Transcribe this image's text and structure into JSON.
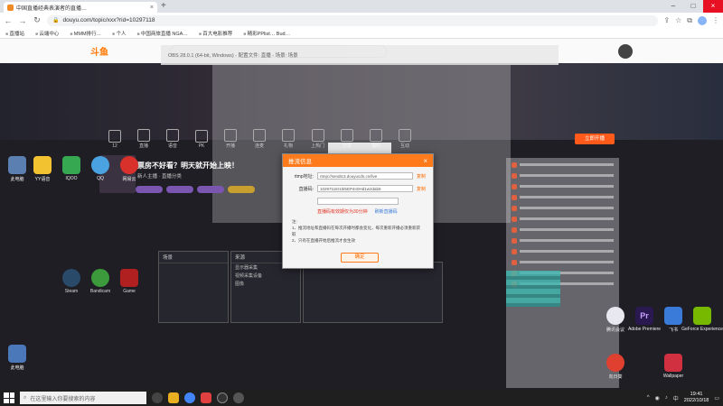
{
  "browser": {
    "tab_title": "中国直播经典表演者的直播…",
    "url": "douyu.com/topic/xxx?rid=10297118",
    "bookmarks": [
      "直播站",
      "云端中心",
      "MMM排行…",
      "个人",
      "中国商旅直播 NGA…",
      "百大电影推荐",
      "精彩PPlist… Bud…"
    ]
  },
  "site": {
    "logo": "斗鱼",
    "search_placeholder": ""
  },
  "stream": {
    "title": "票房不好看？明天就开始上映！",
    "subtitle": "新人主播 · 直播分类",
    "badge": "立即开播"
  },
  "toolbar_items": [
    "12",
    "直播",
    "语音",
    "PK",
    "开播",
    "连麦",
    "礼物",
    "上热门",
    "分享",
    "福利",
    "互动"
  ],
  "inner_window_title": "OBS 28.0.1 (64-bit, Windows) - 配置文件: 直播 - 场景: 场景",
  "dialog": {
    "title": "推流信息",
    "rtmp_label": "rtmp地址:",
    "rtmp_value": "rtmp://sendtc3.douyucdn.cn/live",
    "rtmp_copy": "复制",
    "key_label": "直播码:",
    "key_value": "10297118r1tlr5EP4n0Hd1w2dab6",
    "key_copy": "复制",
    "third_input": "",
    "warning": "直播码有效期仅为30分钟",
    "warning_link": "刷新直播码",
    "notes_title": "注:",
    "note1": "1、推流地址和直播码在每次开播时都会变化，每次重新开播必须重新获取",
    "note2": "2、只有在直播开始后推流才会生效",
    "confirm": "确定"
  },
  "obs": {
    "scenes_title": "场景",
    "sources_title": "来源",
    "source_items": [
      "显示器采集",
      "视频采集设备",
      "图像"
    ]
  },
  "desktop_icons_left": [
    "此电脑",
    "YY语音",
    "IQOO",
    "QQ",
    "网易云",
    "Steam",
    "Bandicam",
    "Game"
  ],
  "desktop_icons_right": [
    "腾讯会议",
    "Adobe Premiere",
    "飞书",
    "GeForce Experience",
    "向日葵",
    "Wallpaper",
    "此电脑"
  ],
  "taskbar": {
    "search_placeholder": "在这里输入你要搜索的内容",
    "time": "19:41",
    "date": "2022/10/18",
    "lang": "中"
  }
}
